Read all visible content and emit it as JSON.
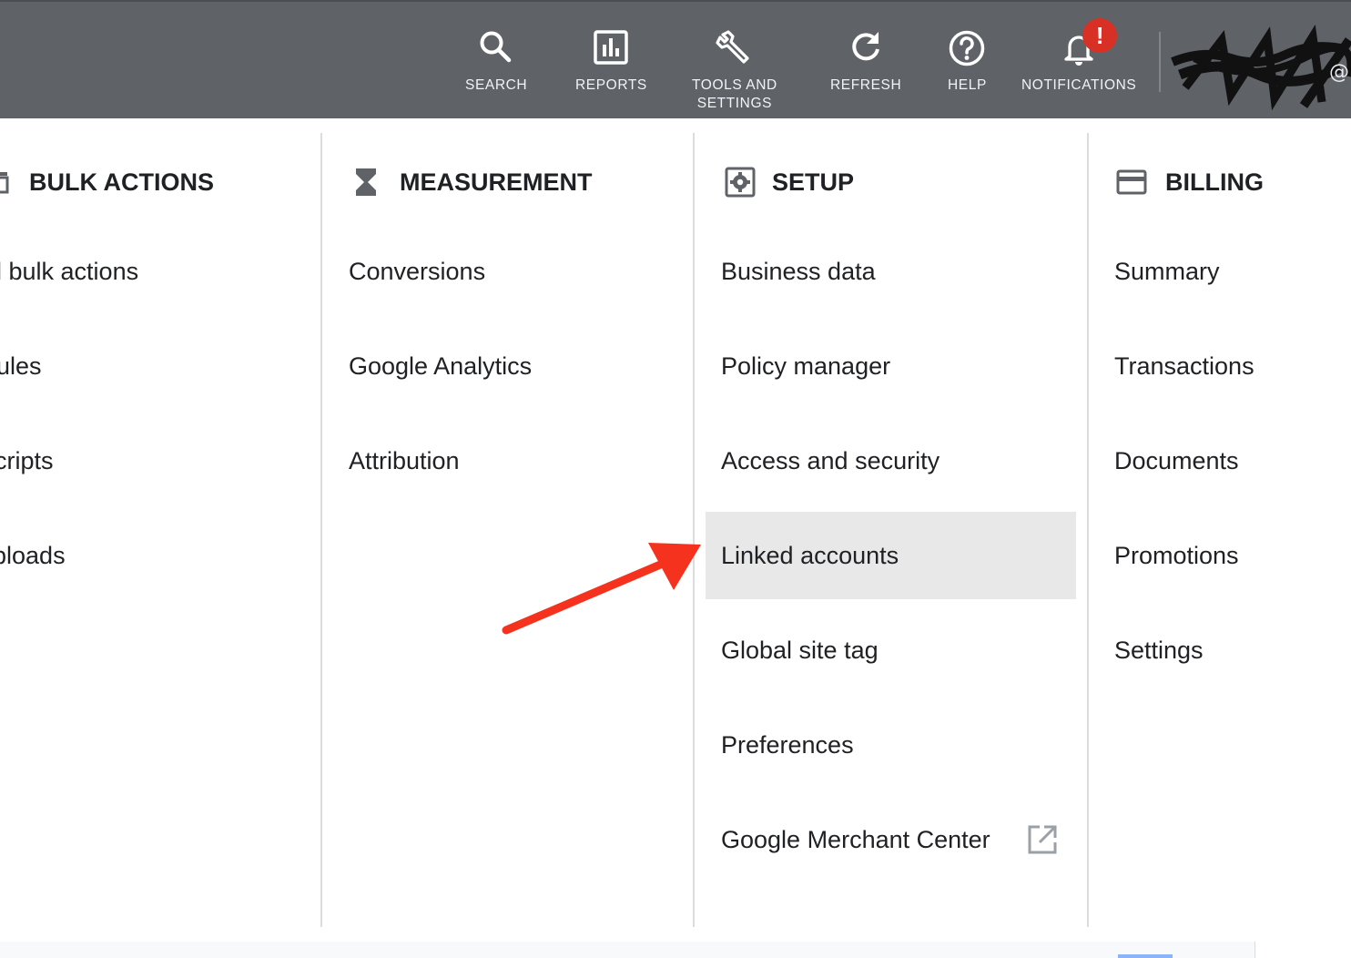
{
  "topbar": {
    "search_label": "SEARCH",
    "reports_label": "REPORTS",
    "tools_label": "TOOLS AND\nSETTINGS",
    "refresh_label": "REFRESH",
    "help_label": "HELP",
    "notifications_label": "NOTIFICATIONS",
    "notification_badge": "!"
  },
  "columns": {
    "bulk": {
      "title": "BULK ACTIONS",
      "items": [
        "l bulk actions",
        "ules",
        "cripts",
        "bloads"
      ]
    },
    "measurement": {
      "title": "MEASUREMENT",
      "items": [
        "Conversions",
        "Google Analytics",
        "Attribution"
      ]
    },
    "setup": {
      "title": "SETUP",
      "items": [
        "Business data",
        "Policy manager",
        "Access and security",
        "Linked accounts",
        "Global site tag",
        "Preferences",
        "Google Merchant Center"
      ],
      "highlighted": "Linked accounts"
    },
    "billing": {
      "title": "BILLING",
      "items": [
        "Summary",
        "Transactions",
        "Documents",
        "Promotions",
        "Settings"
      ]
    }
  },
  "colors": {
    "topbar": "#5f6368",
    "highlight": "#e8e8e8",
    "arrow": "#f4321e",
    "badge": "#d93025"
  }
}
